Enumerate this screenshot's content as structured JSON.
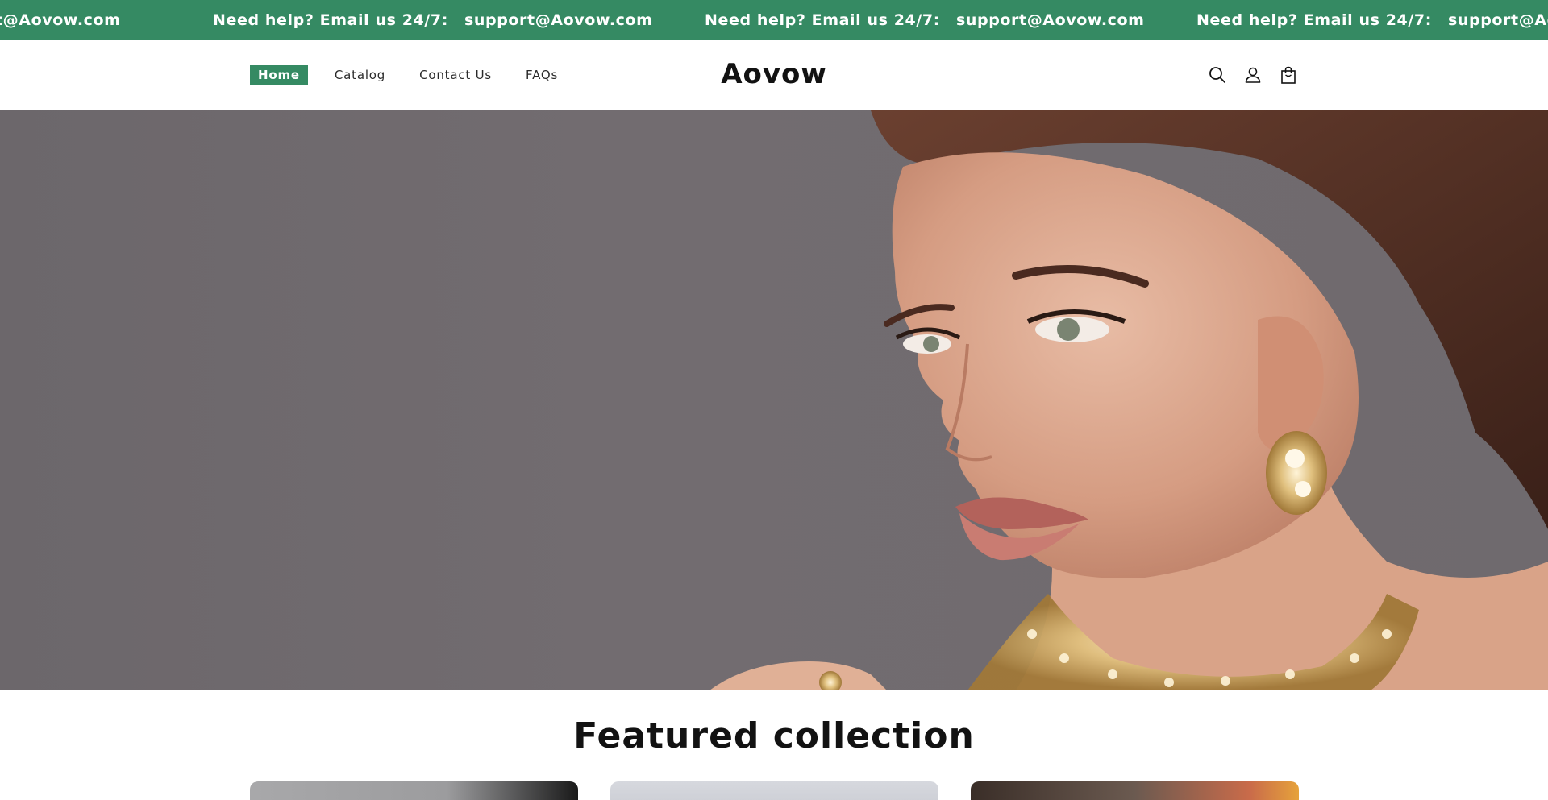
{
  "announcement": {
    "lead": "Need help? Email us 24/7:",
    "email": "support@Aovow.com",
    "fragment": "t@Aovow.com",
    "bg_color": "#358a63"
  },
  "header": {
    "nav": [
      {
        "label": "Home",
        "active": true
      },
      {
        "label": "Catalog",
        "active": false
      },
      {
        "label": "Contact Us",
        "active": false
      },
      {
        "label": "FAQs",
        "active": false
      }
    ],
    "logo": "Aovow",
    "icons": [
      "search-icon",
      "account-icon",
      "cart-icon"
    ]
  },
  "hero": {
    "image": "woman wearing gold crystal earrings and necklace"
  },
  "featured": {
    "title": "Featured collection"
  }
}
